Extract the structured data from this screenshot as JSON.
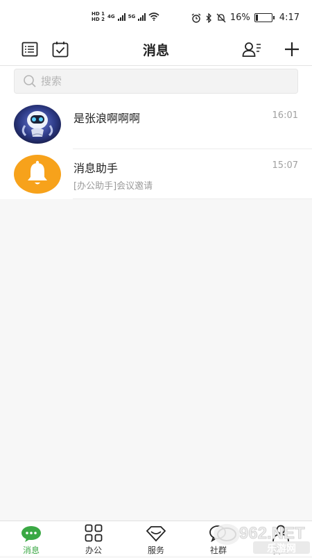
{
  "status_bar": {
    "hd1": "HD 1",
    "hd2": "HD 2",
    "net1": "4G",
    "net2": "5G",
    "battery_percent": "16%",
    "battery_level": 0.16,
    "time": "4:17"
  },
  "header": {
    "title": "消息",
    "left_icons": [
      "list-icon",
      "checklist-icon"
    ],
    "right_icons": [
      "contacts-icon",
      "plus-icon"
    ]
  },
  "search": {
    "placeholder": "搜索",
    "value": ""
  },
  "conversations": [
    {
      "name": "是张浪啊啊啊",
      "time": "16:01",
      "preview": "",
      "avatar": "robot-avatar"
    },
    {
      "name": "消息助手",
      "time": "15:07",
      "preview": "[办公助手]会议邀请",
      "avatar": "bell-icon",
      "avatar_color": "#f7a21b"
    }
  ],
  "tabs": [
    {
      "label": "消息",
      "icon": "chat-bubble-icon",
      "active": true
    },
    {
      "label": "办公",
      "icon": "grid-icon",
      "active": false
    },
    {
      "label": "服务",
      "icon": "diamond-icon",
      "active": false
    },
    {
      "label": "社群",
      "icon": "community-icon",
      "active": false
    },
    {
      "label": "我的",
      "icon": "profile-icon",
      "active": false
    }
  ],
  "watermark": {
    "text1": "962.NET",
    "text2": "乐游网"
  },
  "colors": {
    "accent": "#3aa844",
    "bell_bg": "#f7a21b",
    "background": "#f7f7f7"
  }
}
